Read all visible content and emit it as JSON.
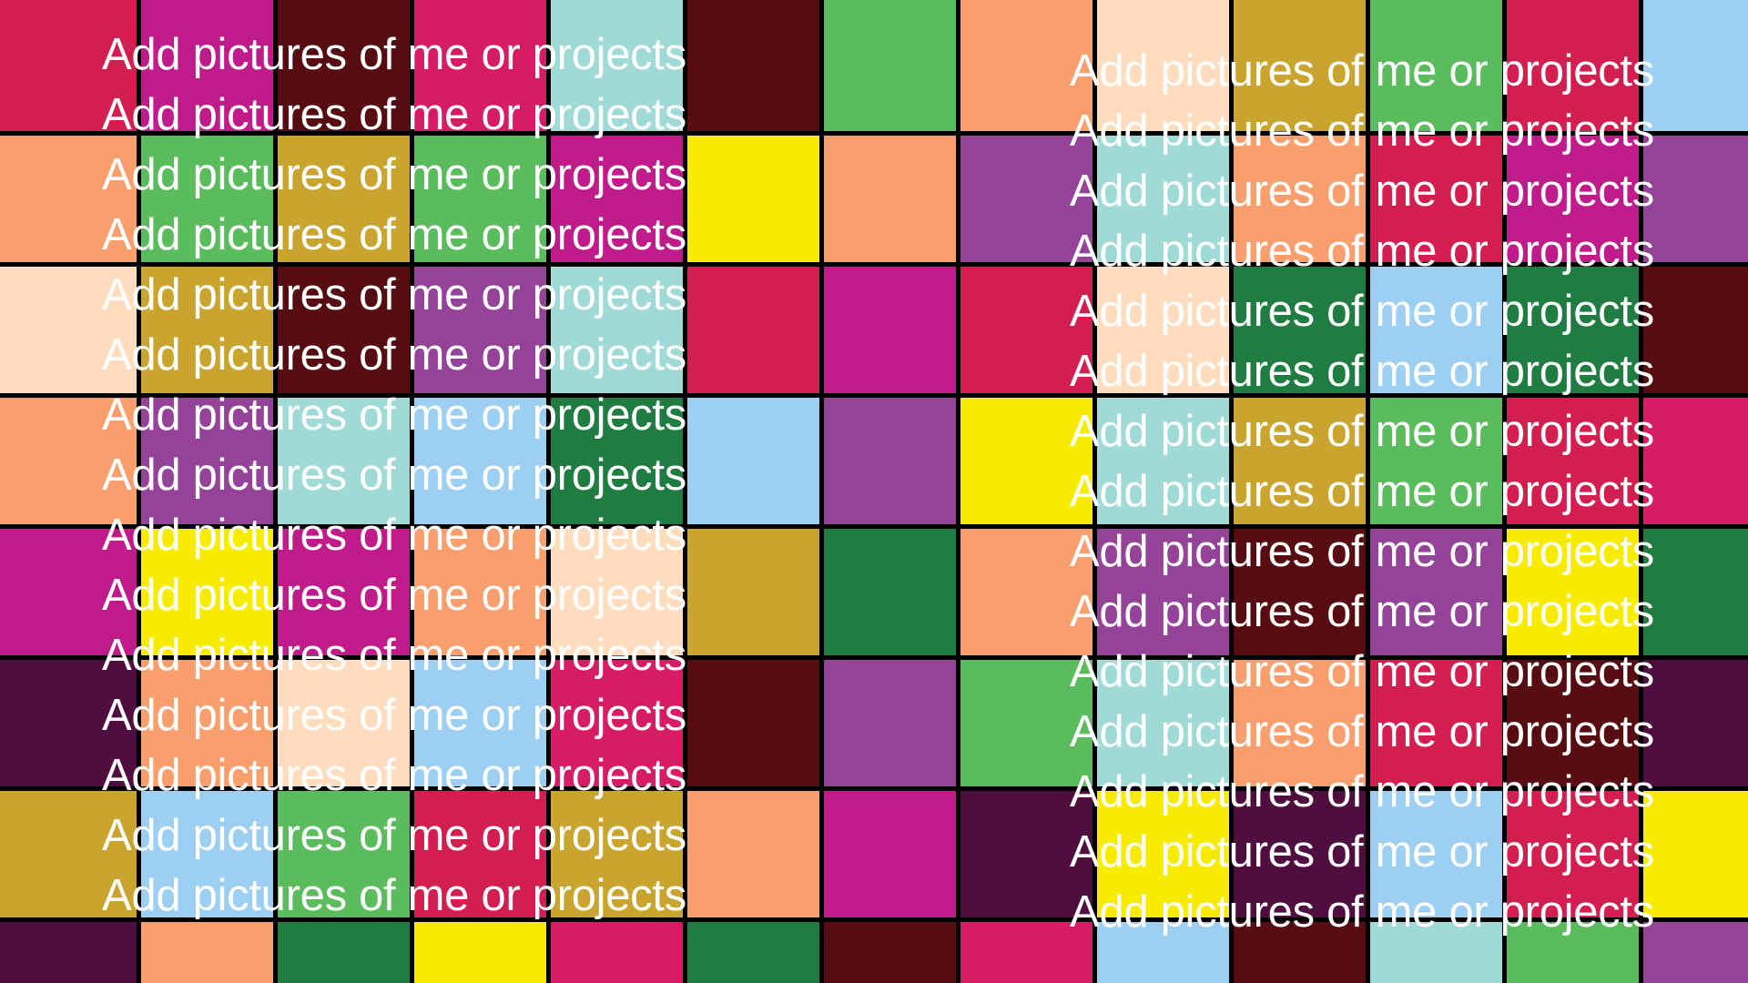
{
  "caption_text": "Add pictures of me or projects",
  "palette": {
    "crimson": "#d21f50",
    "magenta": "#c01b8b",
    "maroon": "#560c10",
    "pink": "#d61c64",
    "aqua": "#9fdad6",
    "green": "#5bbc5d",
    "orange": "#f99f6d",
    "peach": "#ffdcbe",
    "gold": "#c9a52f",
    "sky": "#9ccff1",
    "yellow": "#f7ec00",
    "purple": "#954399",
    "darkgreen": "#207d41",
    "plum": "#4f0e3f"
  },
  "tiles": [
    [
      "crimson",
      "magenta",
      "maroon",
      "pink",
      "aqua",
      "maroon",
      "green",
      "orange",
      "peach",
      "gold",
      "green",
      "crimson",
      "sky"
    ],
    [
      "orange",
      "green",
      "gold",
      "green",
      "magenta",
      "yellow",
      "orange",
      "purple",
      "aqua",
      "orange",
      "crimson",
      "magenta",
      "purple"
    ],
    [
      "peach",
      "gold",
      "maroon",
      "purple",
      "aqua",
      "crimson",
      "magenta",
      "crimson",
      "peach",
      "darkgreen",
      "sky",
      "darkgreen",
      "maroon"
    ],
    [
      "orange",
      "purple",
      "aqua",
      "sky",
      "darkgreen",
      "sky",
      "purple",
      "yellow",
      "aqua",
      "gold",
      "green",
      "crimson",
      "pink"
    ],
    [
      "magenta",
      "yellow",
      "magenta",
      "orange",
      "peach",
      "gold",
      "darkgreen",
      "orange",
      "purple",
      "maroon",
      "purple",
      "yellow",
      "darkgreen"
    ],
    [
      "plum",
      "orange",
      "peach",
      "sky",
      "pink",
      "maroon",
      "purple",
      "green",
      "aqua",
      "orange",
      "crimson",
      "maroon",
      "plum"
    ],
    [
      "gold",
      "sky",
      "green",
      "crimson",
      "gold",
      "orange",
      "magenta",
      "plum",
      "yellow",
      "plum",
      "sky",
      "crimson",
      "yellow"
    ],
    [
      "plum",
      "orange",
      "darkgreen",
      "yellow",
      "pink",
      "darkgreen",
      "maroon",
      "pink",
      "sky",
      "maroon",
      "aqua",
      "green",
      "purple"
    ]
  ]
}
